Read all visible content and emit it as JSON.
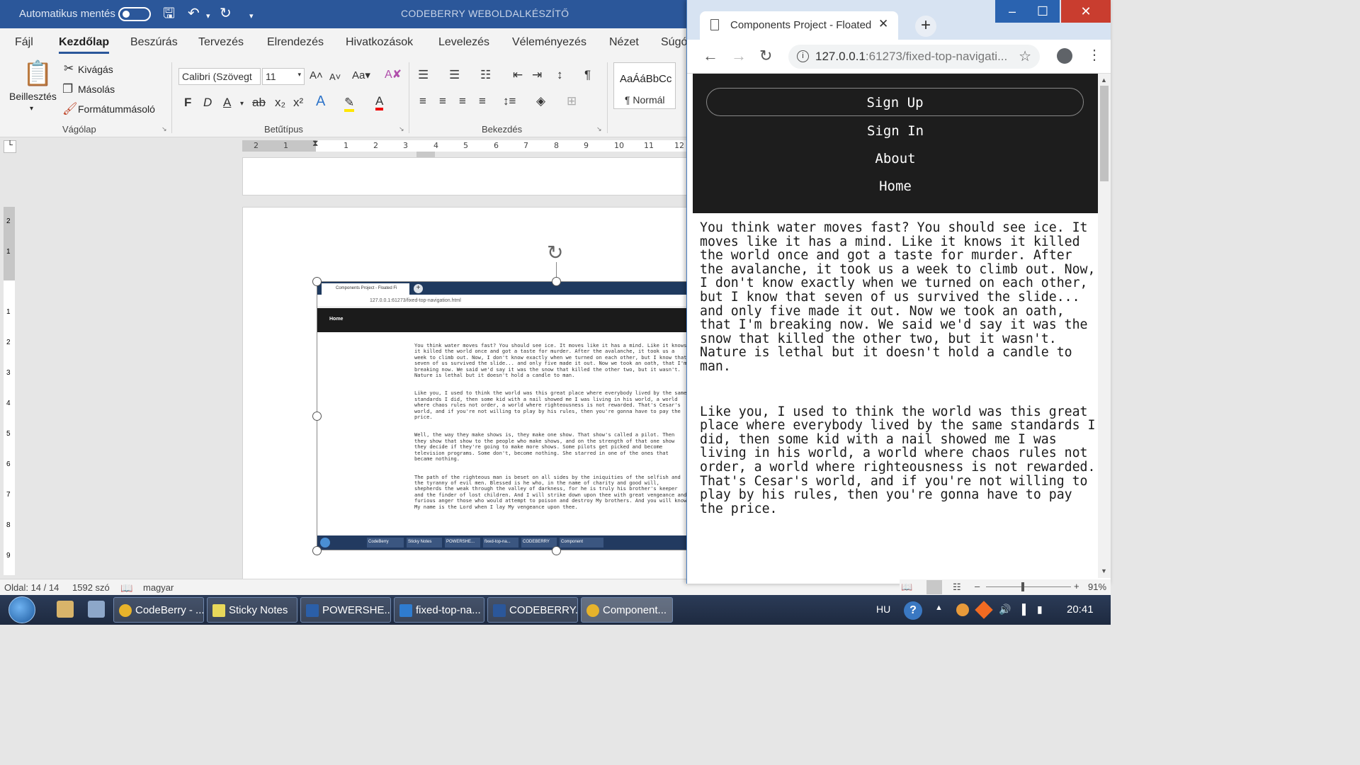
{
  "word": {
    "titlebar": {
      "autosave_label": "Automatikus mentés",
      "doc_title": "CODEBERRY WEBOLDALKÉSZÍTŐ"
    },
    "tabs": [
      "Fájl",
      "Kezdőlap",
      "Beszúrás",
      "Tervezés",
      "Elrendezés",
      "Hivatkozások",
      "Levelezés",
      "Véleményezés",
      "Nézet",
      "Súgó"
    ],
    "active_tab": "Kezdőlap",
    "clipboard": {
      "paste": "Beillesztés",
      "cut": "Kivágás",
      "copy": "Másolás",
      "format_painter": "Formátummásoló",
      "group": "Vágólap"
    },
    "font": {
      "family": "Calibri (Szövegt",
      "size": "11",
      "group": "Betűtípus"
    },
    "paragraph": {
      "group": "Bekezdés"
    },
    "styles": {
      "preview": "AaÁáBbCc",
      "normal": "¶ Normál"
    },
    "ruler_ticks": [
      "2",
      "1",
      "1",
      "2",
      "3",
      "4",
      "5",
      "6",
      "7",
      "8",
      "9",
      "10",
      "11",
      "12"
    ],
    "vruler_ticks": [
      "2",
      "1",
      "1",
      "2",
      "3",
      "4",
      "5",
      "6",
      "7",
      "8",
      "9"
    ],
    "statusbar": {
      "page": "Oldal: 14 / 14",
      "words": "1592 szó",
      "language": "magyar",
      "zoom": "91%"
    }
  },
  "embedded": {
    "tab_title": "Components Project - Floated Fi",
    "url": "127.0.0.1:61273/fixed-top-navigation.html",
    "nav_home": "Home",
    "paragraphs": [
      "You think water moves fast? You should see ice. It moves like it has a mind. Like it knows it killed the world once and got a taste for murder. After the avalanche, it took us a week to climb out. Now, I don't know exactly when we turned on each other, but I know that seven of us survived the slide... and only five made it out. Now we took an oath, that I'm breaking now. We said we'd say it was the snow that killed the other two, but it wasn't. Nature is lethal but it doesn't hold a candle to man.",
      "Like you, I used to think the world was this great place where everybody lived by the same standards I did, then some kid with a nail showed me I was living in his world, a world where chaos rules not order, a world where righteousness is not rewarded. That's Cesar's world, and if you're not willing to play by his rules, then you're gonna have to pay the price.",
      "Well, the way they make shows is, they make one show. That show's called a pilot. Then they show that show to the people who make shows, and on the strength of that one show they decide if they're going to make more shows. Some pilots get picked and become television programs. Some don't, become nothing. She starred in one of the ones that became nothing.",
      "The path of the righteous man is beset on all sides by the iniquities of the selfish and the tyranny of evil men. Blessed is he who, in the name of charity and good will, shepherds the weak through the valley of darkness, for he is truly his brother's keeper and the finder of lost children. And I will strike down upon thee with great vengeance and furious anger those who would attempt to poison and destroy My brothers. And you will know My name is the Lord when I lay My vengeance upon thee."
    ],
    "taskbar_items": [
      "CodeBerry",
      "Sticky Notes",
      "POWERSHE...",
      "fixed-top-na...",
      "CODEBERRY",
      "Component"
    ]
  },
  "chrome": {
    "tab_title": "Components Project - Floated Fi",
    "url_host": "127.0.0.1",
    "url_rest": ":61273/fixed-top-navigati...",
    "nav": {
      "signup": "Sign Up",
      "signin": "Sign In",
      "about": "About",
      "home": "Home"
    },
    "paragraphs": [
      "You think water moves fast? You should see ice. It moves like it has a mind. Like it knows it killed the world once and got a taste for murder. After the avalanche, it took us a week to climb out. Now, I don't know exactly when we turned on each other, but I know that seven of us survived the slide... and only five made it out. Now we took an oath, that I'm breaking now. We said we'd say it was the snow that killed the other two, but it wasn't. Nature is lethal but it doesn't hold a candle to man.",
      "Like you, I used to think the world was this great place where everybody lived by the same standards I did, then some kid with a nail showed me I was living in his world, a world where chaos rules not order, a world where righteousness is not rewarded. That's Cesar's world, and if you're not willing to play by his rules, then you're gonna have to pay the price."
    ]
  },
  "taskbar": {
    "items": [
      "CodeBerry - ...",
      "Sticky Notes",
      "POWERSHE...",
      "fixed-top-na...",
      "CODEBERRY...",
      "Component..."
    ],
    "language": "HU",
    "time": "20:41"
  },
  "colors": {
    "word_blue": "#2b579a",
    "chrome_nav_bg": "#1d1d1d",
    "taskbar_bg": "#1e2a40"
  }
}
